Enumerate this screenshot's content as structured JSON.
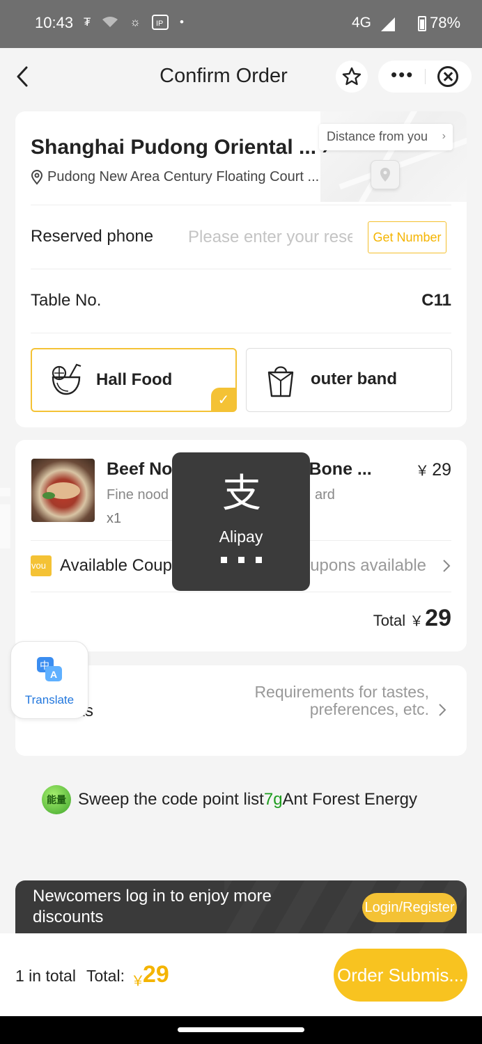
{
  "status_bar": {
    "time": "10:43",
    "network": "4G",
    "signal_mark": "R",
    "battery": "78%"
  },
  "nav": {
    "title": "Confirm Order"
  },
  "store": {
    "name": "Shanghai Pudong Oriental ...",
    "address": "Pudong New Area Century Floating Court ...",
    "distance_label": "Distance from you"
  },
  "reserved_phone": {
    "label": "Reserved phone",
    "placeholder": "Please enter your reserved phone",
    "get_number": "Get Number"
  },
  "table": {
    "label": "Table No.",
    "value": "C11"
  },
  "dining_options": {
    "hall": "Hall Food",
    "outer": "outer band",
    "selected": "Hall Food"
  },
  "item": {
    "name_left": "Beef No",
    "name_right": "Bone ...",
    "price_symbol": "￥",
    "price": "29",
    "desc_left": "Fine nood",
    "desc_right": "ard",
    "qty": "x1"
  },
  "coupon": {
    "badge": "vou",
    "label": "Available Coup",
    "status": "upons available"
  },
  "total": {
    "label": "Total",
    "symbol": "￥",
    "amount": "29"
  },
  "remarks": {
    "label": "ks",
    "hint": "Requirements for tastes, preferences, etc."
  },
  "translate": {
    "label": "Translate"
  },
  "energy": {
    "badge": "能量",
    "prefix": "Sweep the code point list",
    "amount": "7g",
    "suffix": "Ant Forest Energy"
  },
  "promo": {
    "text": "Newcomers log in to enjoy more discounts",
    "button": "Login/Register"
  },
  "bottom": {
    "count": "1 in total",
    "total_label": "Total:",
    "symbol": "￥",
    "amount": "29",
    "submit": "Order Submis..."
  },
  "loading": {
    "label": "Alipay"
  },
  "colors": {
    "accent": "#f4c235",
    "price_accent": "#f4b400",
    "energy_green": "#1e9c1e",
    "dark_panel": "#3a3a3a"
  }
}
